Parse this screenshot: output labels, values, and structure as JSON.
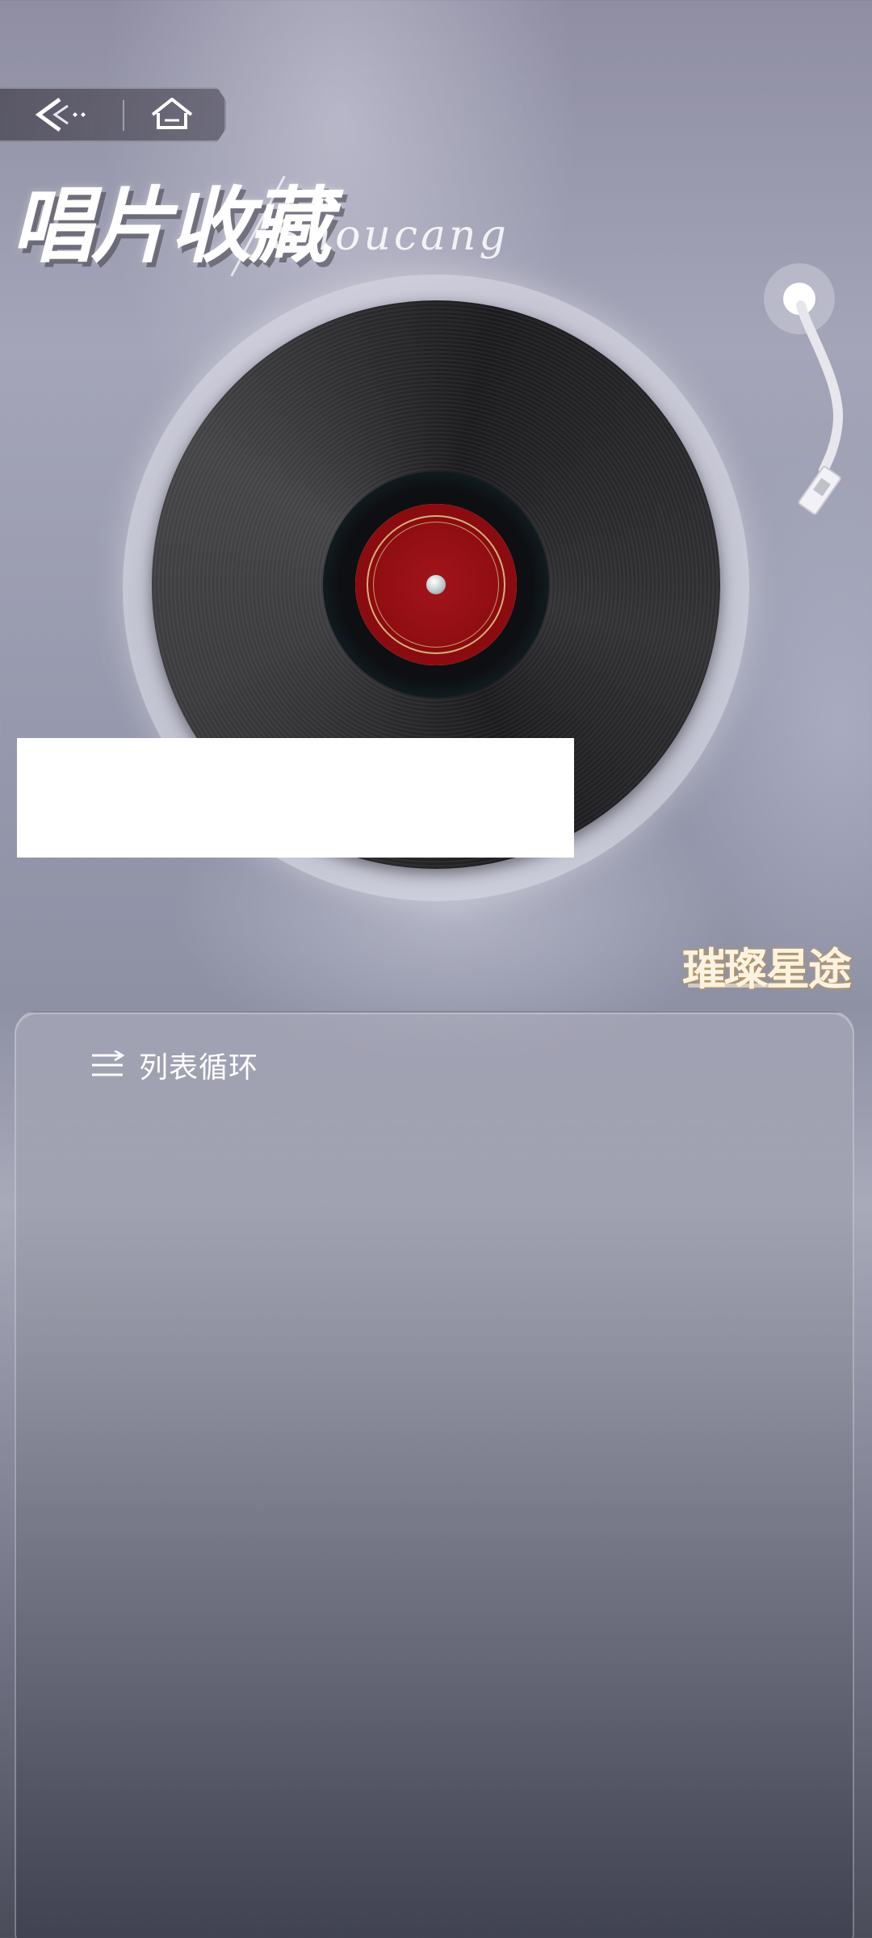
{
  "header": {
    "title": "唱片收藏",
    "subtitle": "Shoucang",
    "back_icon": "back-arrow-sparkle-icon",
    "home_icon": "home-icon"
  },
  "player": {
    "record_icon": "vinyl-record",
    "tonearm_icon": "tonearm-icon"
  },
  "brand": {
    "logo_text": "璀璨星途"
  },
  "playlist": {
    "loop_mode_label": "列表循环",
    "loop_mode_icon": "list-loop-icon"
  },
  "colors": {
    "label_red": "#8a0c10",
    "text_white": "#ffffff",
    "logo_gold": "#d8b07a"
  }
}
